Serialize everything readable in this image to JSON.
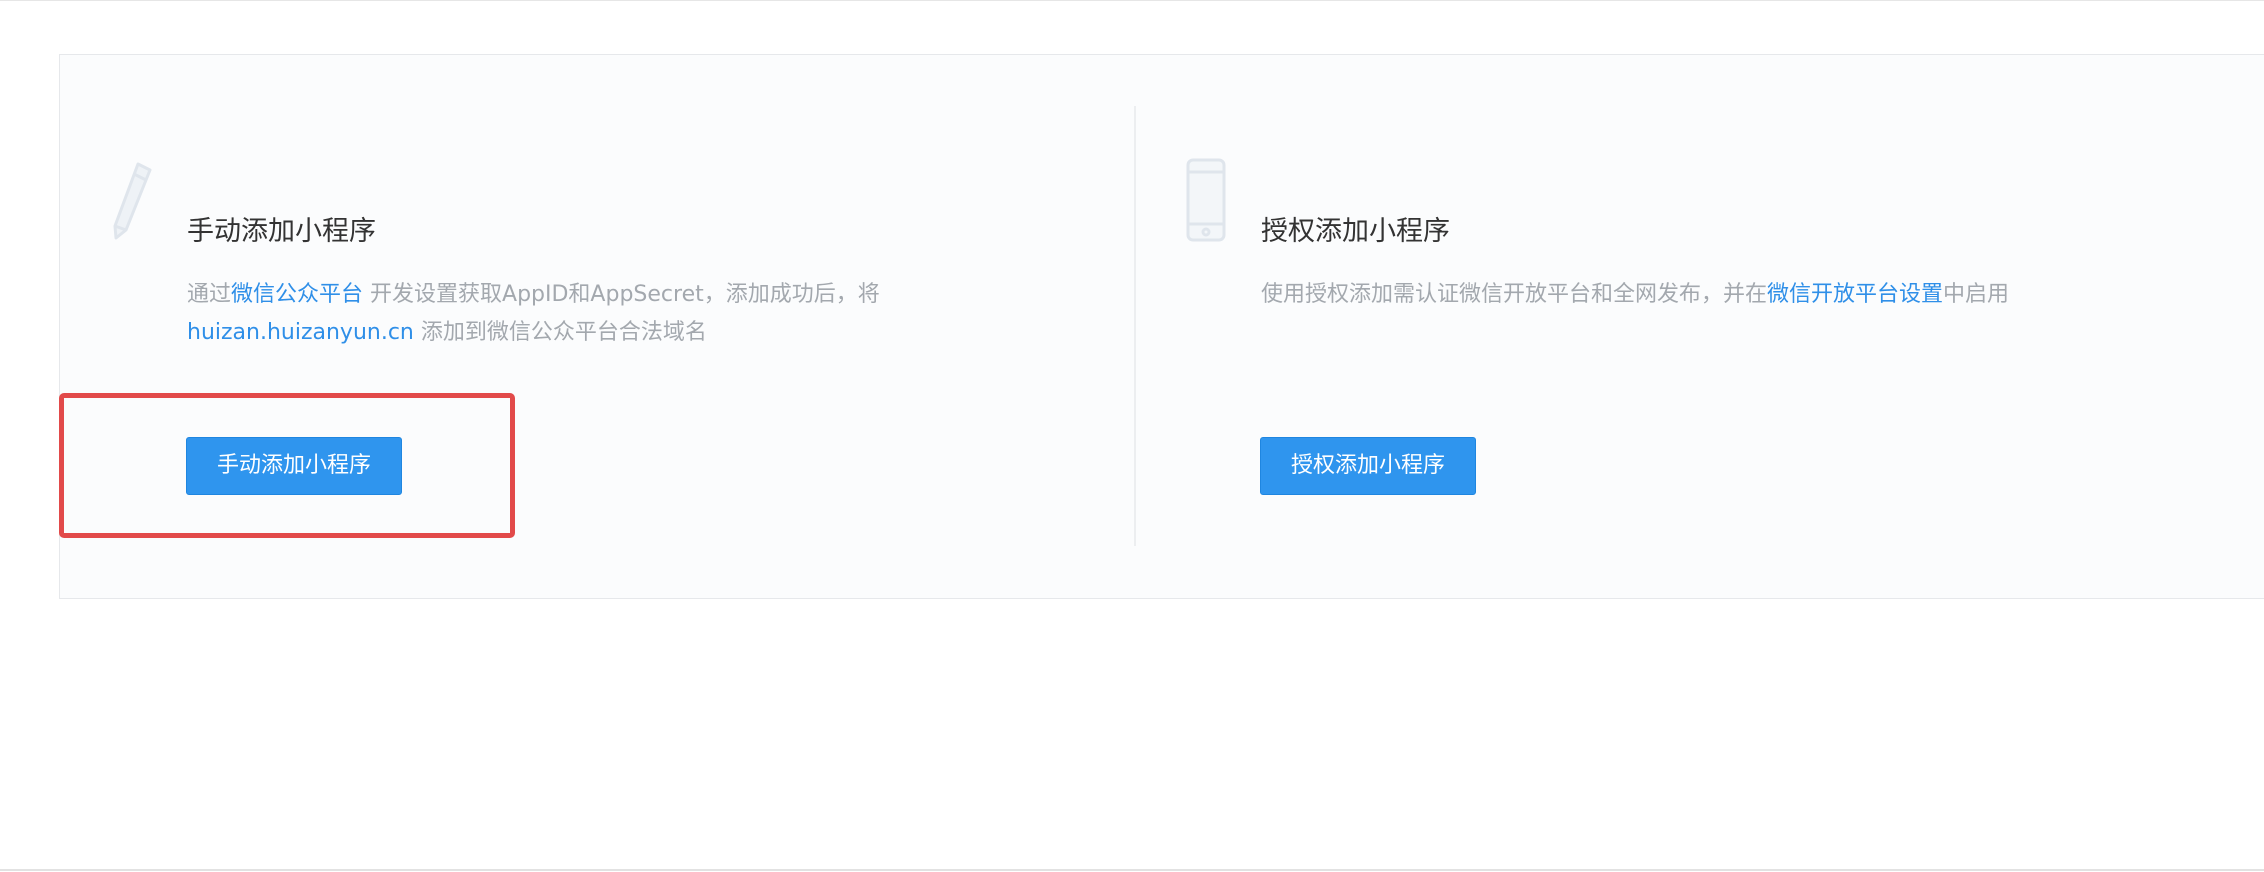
{
  "manual": {
    "title": "手动添加小程序",
    "desc_line1_prefix": "通过",
    "desc_line1_link": "微信公众平台",
    "desc_line1_suffix": " 开发设置获取AppID和AppSecret，添加成功后，将",
    "desc_line2_link": "huizan.huizanyun.cn",
    "desc_line2_suffix": " 添加到微信公众平台合法域名",
    "button_label": "手动添加小程序",
    "icon": "pencil-icon"
  },
  "authorized": {
    "title": "授权添加小程序",
    "desc_prefix": "使用授权添加需认证微信开放平台和全网发布，并在",
    "desc_link": "微信开放平台设置",
    "desc_suffix": "中启用",
    "button_label": "授权添加小程序",
    "icon": "phone-icon"
  },
  "colors": {
    "accent": "#2f95ee",
    "link": "#2f8fe8",
    "highlight": "#e24a4a"
  }
}
